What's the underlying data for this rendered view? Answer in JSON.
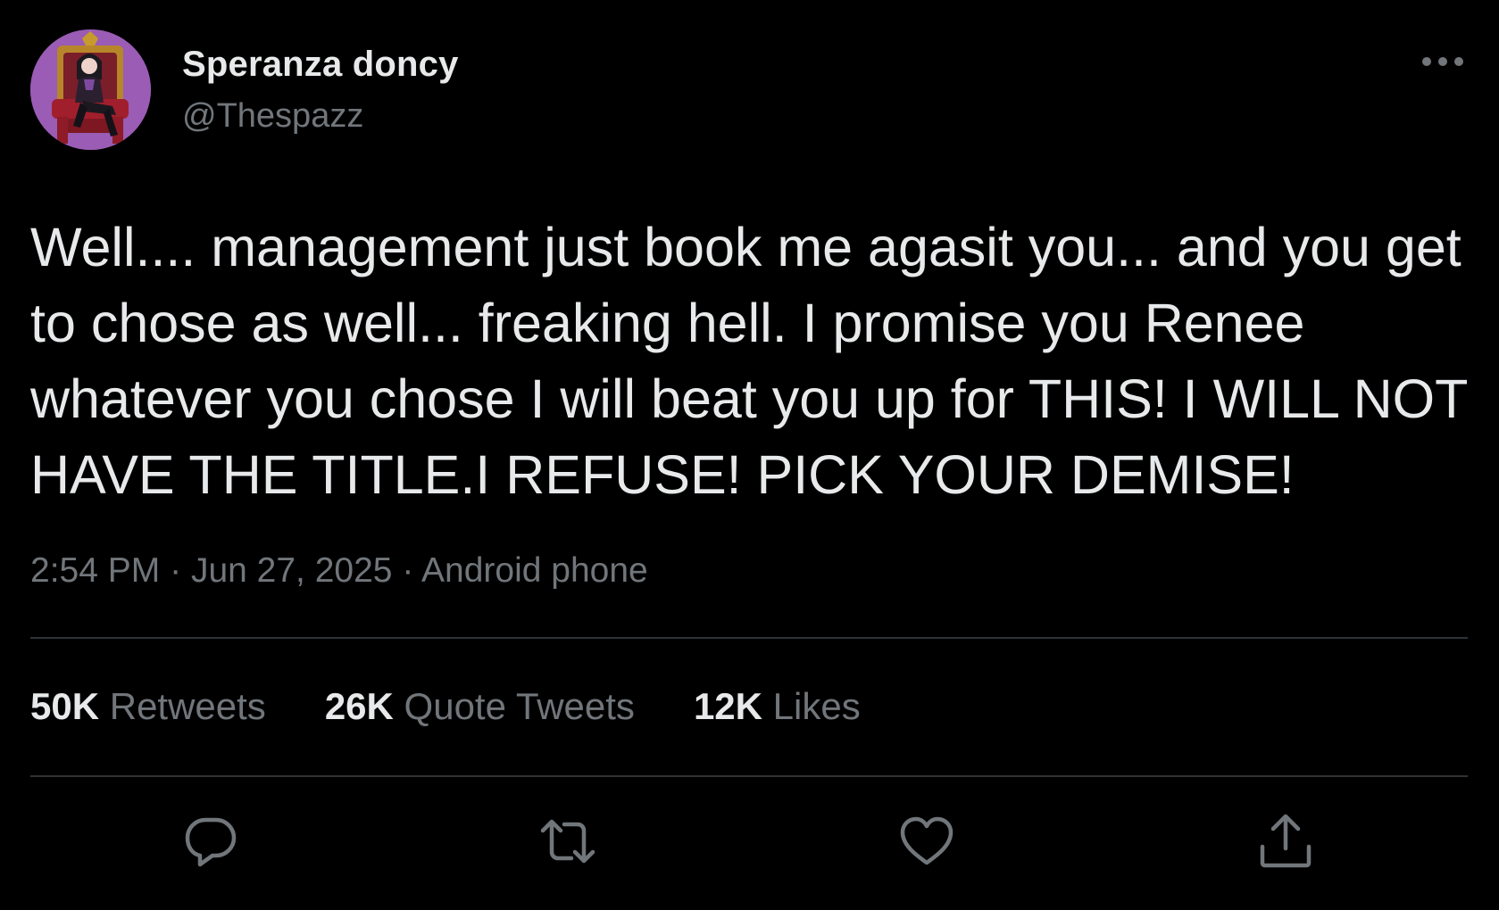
{
  "author": {
    "display_name": "Speranza doncy",
    "handle": "@Thespazz",
    "avatar_icon": "throne-character-avatar"
  },
  "tweet": {
    "text": "Well.... management just book me agasit you... and you get to chose as well... freaking hell. I promise you Renee whatever you chose I will beat you up for THIS! I WILL NOT HAVE THE TITLE.I REFUSE! PICK YOUR DEMISE!",
    "time": "2:54 PM",
    "separator": "·",
    "date": "Jun 27, 2025",
    "source": "Android phone"
  },
  "stats": {
    "retweets_count": "50K",
    "retweets_label": "Retweets",
    "quotes_count": "26K",
    "quotes_label": "Quote Tweets",
    "likes_count": "12K",
    "likes_label": "Likes"
  },
  "actions": [
    "reply-icon",
    "retweet-icon",
    "like-icon",
    "share-icon"
  ],
  "colors": {
    "background": "#000000",
    "primary_text": "#e7e9ea",
    "secondary_text": "#71767b",
    "divider": "#2f3336"
  }
}
